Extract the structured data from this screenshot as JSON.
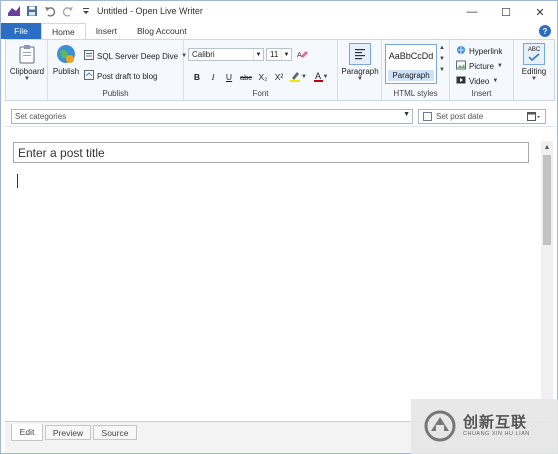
{
  "window": {
    "title": "Untitled - Open Live Writer",
    "controls": {
      "minimize": "—",
      "maximize": "☐",
      "close": "✕"
    }
  },
  "ribbon_tabs": [
    {
      "label": "File"
    },
    {
      "label": "Home"
    },
    {
      "label": "Insert"
    },
    {
      "label": "Blog Account"
    }
  ],
  "help_label": "?",
  "groups": {
    "clipboard": {
      "button": "Clipboard"
    },
    "publish": {
      "label": "Publish",
      "publish_button": "Publish",
      "blog_selector": "SQL Server Deep Dive",
      "post_draft": "Post draft to blog"
    },
    "font": {
      "label": "Font",
      "font_name": "Calibri",
      "font_size": "11",
      "bold": "B",
      "italic": "I",
      "underline": "U",
      "strikethrough": "abc",
      "subscript": "X₂",
      "superscript": "X²",
      "font_color": "A"
    },
    "paragraph": {
      "button": "Paragraph"
    },
    "html_styles": {
      "label": "HTML styles",
      "sample": "AaBbCcDd",
      "style_name": "Paragraph"
    },
    "insert": {
      "label": "Insert",
      "hyperlink": "Hyperlink",
      "picture": "Picture",
      "video": "Video"
    },
    "editing": {
      "button": "Editing",
      "icon_text": "ABC"
    }
  },
  "category_bar": {
    "categories_placeholder": "Set categories",
    "post_date_label": "Set post date"
  },
  "editor": {
    "title_placeholder": "Enter a post title"
  },
  "view_tabs": [
    {
      "label": "Edit",
      "active": true
    },
    {
      "label": "Preview",
      "active": false
    },
    {
      "label": "Source",
      "active": false
    }
  ],
  "watermark": {
    "text": "创新互联",
    "subtext": "CHUANG XIN HU LIAN"
  },
  "colors": {
    "accent": "#2b6fc4",
    "ribbon_bg": "#f5f8fc",
    "style_highlight": "#cfe2f7"
  }
}
